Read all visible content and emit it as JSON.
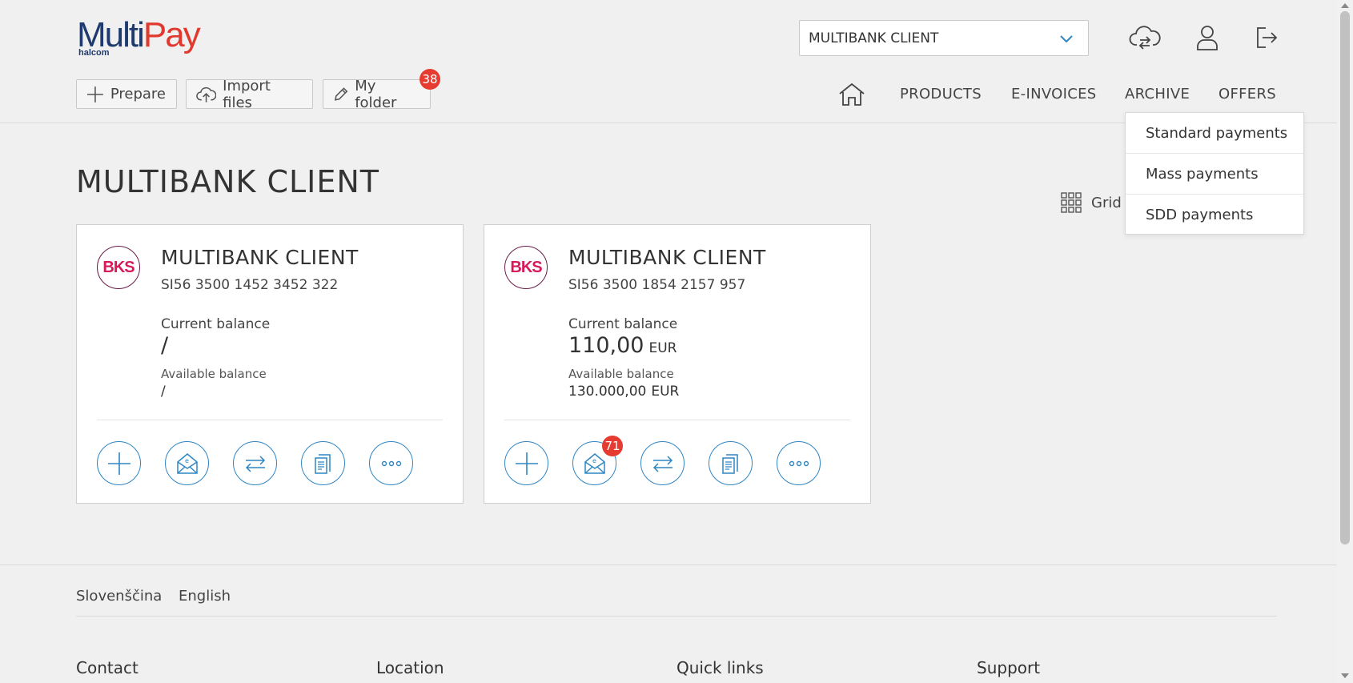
{
  "brand": {
    "logo_multi": "Multi",
    "logo_pay": "Pay",
    "logo_sub": "halcom"
  },
  "header": {
    "client_select": "MULTIBANK CLIENT",
    "icons": [
      "cloud-sync-icon",
      "user-icon",
      "logout-icon"
    ],
    "toolbar": {
      "prepare_label": "Prepare",
      "import_label": "Import files",
      "folder_label": "My folder",
      "folder_badge": "38"
    },
    "nav": {
      "products": "PRODUCTS",
      "einvoices": "E-INVOICES",
      "archive": "ARCHIVE",
      "offers": "OFFERS"
    }
  },
  "archive_menu": [
    "Standard payments",
    "Mass payments",
    "SDD payments"
  ],
  "page": {
    "title": "MULTIBANK CLIENT",
    "view_toggle": "Grid"
  },
  "accounts": [
    {
      "bank": "BKS",
      "name": "MULTIBANK CLIENT",
      "iban": "SI56 3500 1452 3452 322",
      "current_label": "Current balance",
      "current_value": "/",
      "current_currency": "",
      "available_label": "Available balance",
      "available_value": "/",
      "available_currency": "",
      "einvoice_badge": ""
    },
    {
      "bank": "BKS",
      "name": "MULTIBANK CLIENT",
      "iban": "SI56 3500 1854 2157 957",
      "current_label": "Current balance",
      "current_value": "110,00",
      "current_currency": "EUR",
      "available_label": "Available balance",
      "available_value": "130.000,00",
      "available_currency": "EUR",
      "einvoice_badge": "71"
    }
  ],
  "footer": {
    "languages": [
      "Slovenščina",
      "English"
    ],
    "columns": [
      "Contact",
      "Location",
      "Quick links",
      "Support"
    ]
  },
  "colors": {
    "accent": "#2f86c3",
    "badge": "#e53b30",
    "brand_blue": "#1f3a6e",
    "brand_red": "#e03a2f",
    "bks_red": "#d71a5b"
  }
}
